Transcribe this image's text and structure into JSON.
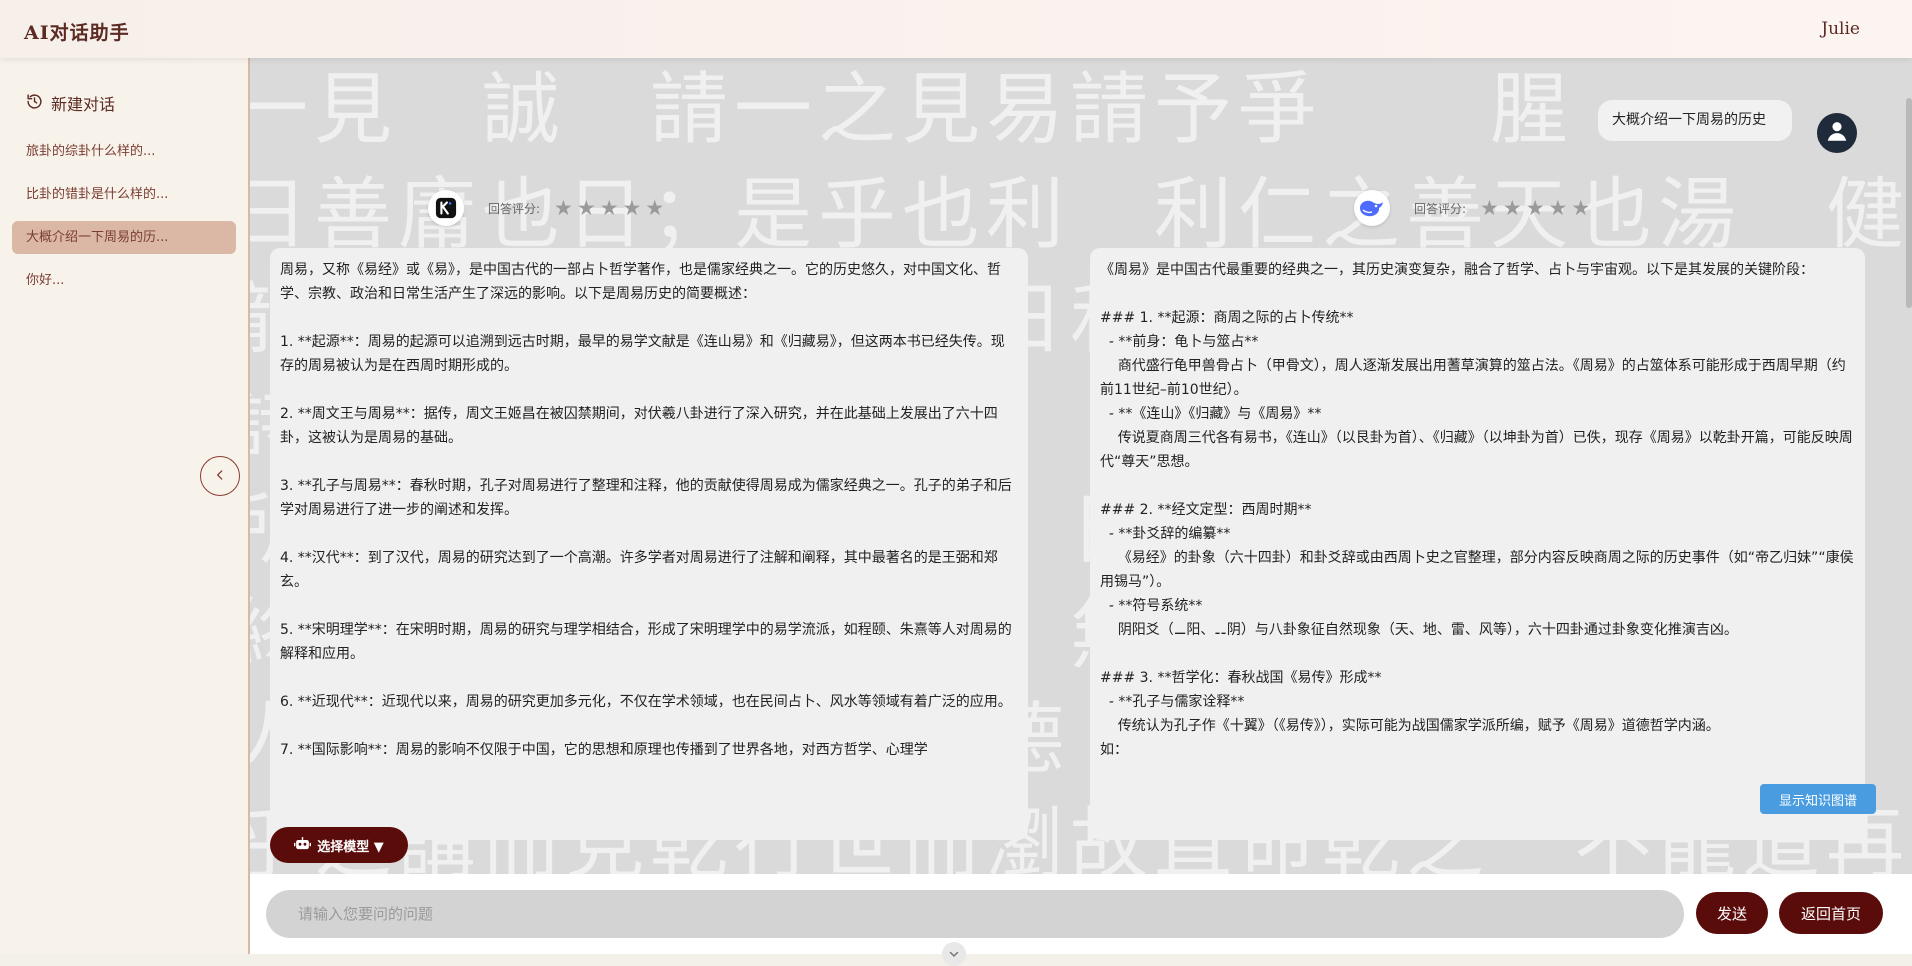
{
  "header": {
    "app_title": "AI对话助手",
    "user_name": "Julie"
  },
  "sidebar": {
    "new_chat_label": "新建对话",
    "history": [
      {
        "label": "旅卦的综卦什么样的...",
        "active": false
      },
      {
        "label": "比卦的错卦是什么样的...",
        "active": false
      },
      {
        "label": "大概介绍一下周易的历...",
        "active": true
      },
      {
        "label": "你好...",
        "active": false
      }
    ]
  },
  "chat": {
    "user_message": "大概介绍一下周易的历史",
    "rating_label": "回答评分:",
    "left_answer": "周易，又称《易经》或《易》，是中国古代的一部占卜哲学著作，也是儒家经典之一。它的历史悠久，对中国文化、哲学、宗教、政治和日常生活产生了深远的影响。以下是周易历史的简要概述：\n\n1. **起源**：周易的起源可以追溯到远古时期，最早的易学文献是《连山易》和《归藏易》，但这两本书已经失传。现存的周易被认为是在西周时期形成的。\n\n2. **周文王与周易**：据传，周文王姬昌在被囚禁期间，对伏羲八卦进行了深入研究，并在此基础上发展出了六十四卦，这被认为是周易的基础。\n\n3. **孔子与周易**：春秋时期，孔子对周易进行了整理和注释，他的贡献使得周易成为儒家经典之一。孔子的弟子和后学对周易进行了进一步的阐述和发挥。\n\n4. **汉代**：到了汉代，周易的研究达到了一个高潮。许多学者对周易进行了注解和阐释，其中最著名的是王弼和郑玄。\n\n5. **宋明理学**：在宋明时期，周易的研究与理学相结合，形成了宋明理学中的易学流派，如程颐、朱熹等人对周易的解释和应用。\n\n6. **近现代**：近现代以来，周易的研究更加多元化，不仅在学术领域，也在民间占卜、风水等领域有着广泛的应用。\n\n7. **国际影响**：周易的影响不仅限于中国，它的思想和原理也传播到了世界各地，对西方哲学、心理学",
    "right_answer": "《周易》是中国古代最重要的经典之一，其历史演变复杂，融合了哲学、占卜与宇宙观。以下是其发展的关键阶段：\n\n### 1. **起源：商周之际的占卜传统**\n  - **前身：龟卜与筮占**\n    商代盛行龟甲兽骨占卜（甲骨文），周人逐渐发展出用蓍草演算的筮占法。《周易》的占筮体系可能形成于西周早期（约前11世纪–前10世纪）。\n  - **《连山》《归藏》与《周易》**\n    传说夏商周三代各有易书，《连山》（以艮卦为首）、《归藏》（以坤卦为首）已佚，现存《周易》以乾卦开篇，可能反映周代“尊天”思想。\n\n### 2. **经文定型：西周时期**\n  - **卦爻辞的编纂**\n    《易经》的卦象（六十四卦）和卦爻辞或由西周卜史之官整理，部分内容反映商周之际的历史事件（如“帝乙归妹”“康侯用锡马”）。\n  - **符号系统**\n    阴阳爻（⚊阳、⚋阴）与八卦象征自然现象（天、地、雷、风等），六十四卦通过卦象变化推演吉凶。\n\n### 3. **哲学化：春秋战国《易传》形成**\n  - **孔子与儒家诠释**\n    传统认为孔子作《十翼》（《易传》），实际可能为战国儒家学派所编，赋予《周易》道德哲学内涵。\n如：",
    "kg_button": "显示知识图谱",
    "model_select": "选择模型 ▼"
  },
  "input": {
    "placeholder": "请输入您要问的问题",
    "send_label": "发送",
    "home_label": "返回首页"
  },
  "background_text": [
    "一見　誠　請一之見易請予爭　　腥",
    "日善庸也日；是乎也利　利仁之善天也湯　健",
    "龍也于乎之。真者物日和之　盪　進終在君",
    "詩　同之善可　謂之。　　也",
    "所皮　　小　行　見　日",
    "終也乃　作　　善　　無　　北",
    "人者之德　利拔炁　德　者　無是庸于",
    "乎之講而見乾行世而瀏故直命乾之　不龍道再息"
  ],
  "colors": {
    "brand_dark": "#5a0c0a",
    "active_history_bg": "#dbb8a6",
    "kg_button": "#4a9ce0",
    "star_inactive": "#9a9a9a"
  }
}
